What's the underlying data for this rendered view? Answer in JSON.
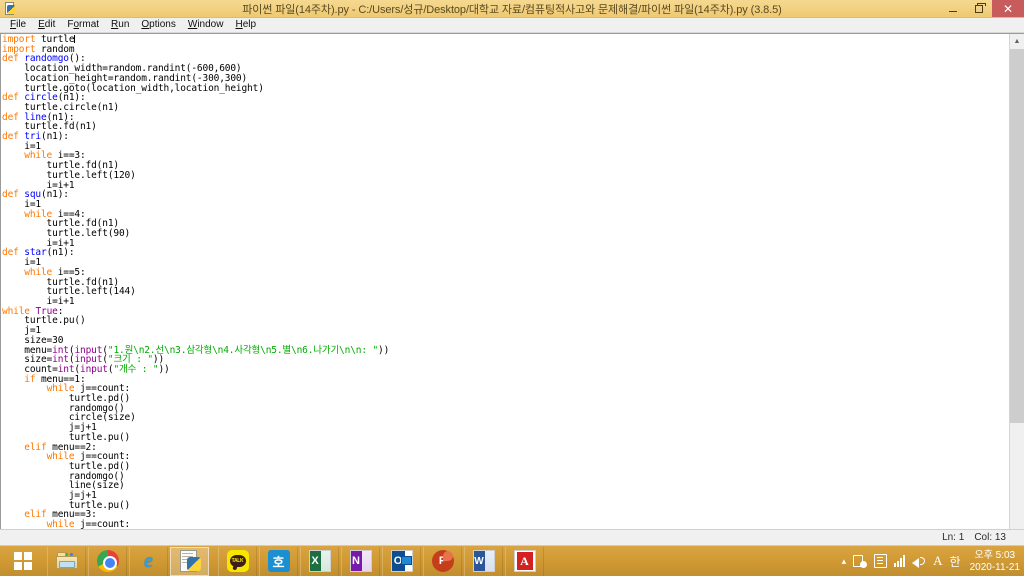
{
  "window": {
    "title": "파이썬 파일(14주차).py - C:/Users/성규/Desktop/대학교 자료/컴퓨팅적사고와 문제해결/파이썬 파일(14주차).py (3.8.5)",
    "app_icon": "python-idle-icon",
    "controls": {
      "minimize": "minimize-icon",
      "maximize": "restore-icon",
      "close": "✕"
    }
  },
  "menubar": {
    "items": [
      {
        "mnemonic": "F",
        "rest": "ile"
      },
      {
        "mnemonic": "E",
        "rest": "dit"
      },
      {
        "pre": "F",
        "mnemonic": "o",
        "rest": "rmat"
      },
      {
        "mnemonic": "R",
        "rest": "un"
      },
      {
        "mnemonic": "O",
        "rest": "ptions"
      },
      {
        "mnemonic": "W",
        "rest": "indow"
      },
      {
        "mnemonic": "H",
        "rest": "elp"
      }
    ]
  },
  "editor": {
    "cursor_line": 1,
    "cursor_col": 13,
    "code_lines": [
      "import turtle",
      "import random",
      "def randomgo():",
      "    location_width=random.randint(-600,600)",
      "    location_height=random.randint(-300,300)",
      "    turtle.goto(location_width,location_height)",
      "def circle(n1):",
      "    turtle.circle(n1)",
      "def line(n1):",
      "    turtle.fd(n1)",
      "def tri(n1):",
      "    i=1",
      "    while i==3:",
      "        turtle.fd(n1)",
      "        turtle.left(120)",
      "        i=i+1",
      "def squ(n1):",
      "    i=1",
      "    while i==4:",
      "        turtle.fd(n1)",
      "        turtle.left(90)",
      "        i=i+1",
      "def star(n1):",
      "    i=1",
      "    while i==5:",
      "        turtle.fd(n1)",
      "        turtle.left(144)",
      "        i=i+1",
      "while True:",
      "    turtle.pu()",
      "    j=1",
      "    size=30",
      "    menu=int(input(\"1.원\\n2.선\\n3.삼각형\\n4.사각형\\n5.별\\n6.나가기\\n\\n: \"))",
      "    size=int(input(\"크기 : \"))",
      "    count=int(input(\"개수 : \"))",
      "    if menu==1:",
      "        while j==count:",
      "            turtle.pd()",
      "            randomgo()",
      "            circle(size)",
      "            j=j+1",
      "            turtle.pu()",
      "    elif menu==2:",
      "        while j==count:",
      "            turtle.pd()",
      "            randomgo()",
      "            line(size)",
      "            j=j+1",
      "            turtle.pu()",
      "    elif menu==3:",
      "        while j==count:"
    ],
    "syntax_colors": {
      "keyword": "#ff7700",
      "definition": "#0000ff",
      "builtin": "#900090",
      "string": "#00aa00",
      "default": "#000000"
    }
  },
  "statusbar": {
    "line_label": "Ln: 1",
    "col_label": "Col: 13"
  },
  "scrollbar": {
    "up_arrow": "▲",
    "down_arrow": "▼"
  },
  "taskbar": {
    "start": {
      "name": "start-button",
      "label": ""
    },
    "items": [
      {
        "name": "taskbar-file-explorer",
        "icon": "folder-icon",
        "label": "File Explorer",
        "active": false
      },
      {
        "name": "taskbar-chrome",
        "icon": "chrome-icon",
        "label": "Google Chrome",
        "active": false
      },
      {
        "name": "taskbar-internet-explorer",
        "icon": "internet-explorer-icon",
        "label": "Internet Explorer",
        "glyph": "e",
        "active": false
      },
      {
        "name": "taskbar-python-idle",
        "icon": "python-idle-icon",
        "label": "Python IDLE",
        "active": true
      },
      {
        "name": "taskbar-kakaotalk",
        "icon": "kakaotalk-icon",
        "label": "KakaoTalk",
        "glyph": "TALK",
        "active": false
      },
      {
        "name": "taskbar-hancom-hangul",
        "icon": "hangul-icon",
        "label": "한글",
        "glyph": "호",
        "active": false
      },
      {
        "name": "taskbar-excel",
        "icon": "excel-icon",
        "label": "Excel",
        "glyph": "X",
        "active": false
      },
      {
        "name": "taskbar-onenote",
        "icon": "onenote-icon",
        "label": "OneNote",
        "glyph": "N",
        "active": false
      },
      {
        "name": "taskbar-outlook",
        "icon": "outlook-icon",
        "label": "Outlook",
        "glyph": "O",
        "active": false
      },
      {
        "name": "taskbar-powerpoint",
        "icon": "powerpoint-icon",
        "label": "PowerPoint",
        "glyph": "P",
        "active": false
      },
      {
        "name": "taskbar-word",
        "icon": "word-icon",
        "label": "Word",
        "glyph": "W",
        "active": false
      },
      {
        "name": "taskbar-acrobat",
        "icon": "acrobat-reader-icon",
        "label": "Adobe Acrobat",
        "glyph": "A",
        "active": false
      }
    ],
    "tray": {
      "chevron": "▴",
      "ime_alpha": "A",
      "ime_korean": "한",
      "time": "오후 5:03",
      "date": "2020-11-21"
    }
  },
  "colors": {
    "titlebar": "#f2d184",
    "taskbar": "#cf9833",
    "close_button": "#c75c5c",
    "editor_bg": "#ffffff"
  }
}
